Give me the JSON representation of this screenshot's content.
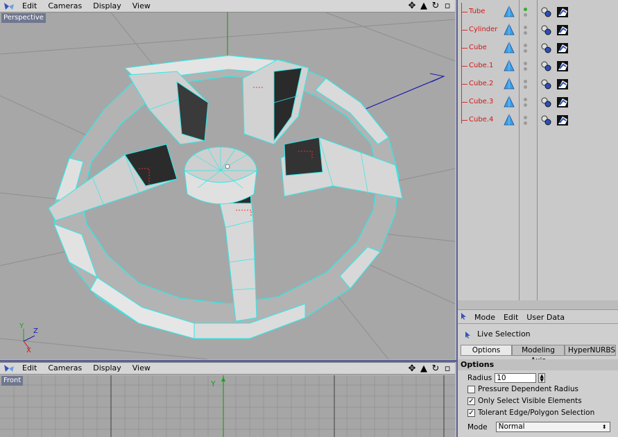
{
  "top_viewport": {
    "menu": [
      "Edit",
      "Cameras",
      "Display",
      "View"
    ],
    "label": "Perspective",
    "axes": {
      "y": "Y",
      "z": "Z",
      "x": "X"
    }
  },
  "bottom_viewport": {
    "menu": [
      "Edit",
      "Cameras",
      "Display",
      "View"
    ],
    "label": "Front",
    "y_axis_label": "Y"
  },
  "object_manager": {
    "objects": [
      {
        "name": "Tube",
        "active": true
      },
      {
        "name": "Cylinder",
        "active": false
      },
      {
        "name": "Cube",
        "active": false
      },
      {
        "name": "Cube.1",
        "active": false
      },
      {
        "name": "Cube.2",
        "active": false
      },
      {
        "name": "Cube.3",
        "active": false
      },
      {
        "name": "Cube.4",
        "active": false
      }
    ]
  },
  "attribute_manager": {
    "menu": [
      "Mode",
      "Edit",
      "User Data"
    ],
    "tool_name": "Live Selection",
    "tabs": [
      "Options",
      "Modeling Axis",
      "HyperNURBS"
    ],
    "active_tab": "Options",
    "section": "Options",
    "radius_label": "Radius",
    "radius_value": "10",
    "pressure_label": "Pressure Dependent Radius",
    "pressure_checked": false,
    "visible_label": "Only Select Visible Elements",
    "visible_checked": true,
    "tolerant_label": "Tolerant Edge/Polygon Selection",
    "tolerant_checked": true,
    "mode_label": "Mode",
    "mode_value": "Normal"
  },
  "colors": {
    "wire": "#2ee8e8",
    "object_name": "#d01818",
    "panel_border": "#5b5f9a",
    "y_axis": "#1aa31a",
    "z_axis": "#1b1bb0",
    "x_axis": "#d01010"
  }
}
